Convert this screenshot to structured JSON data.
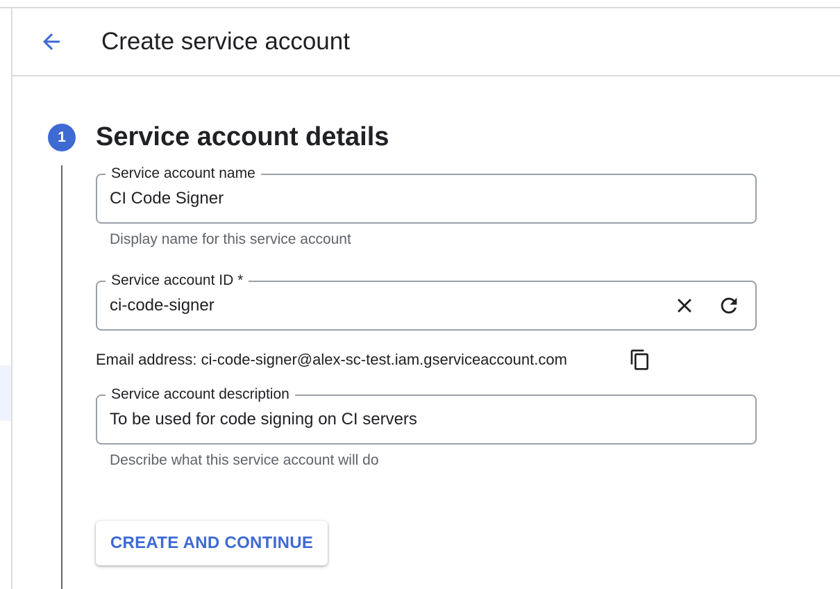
{
  "header": {
    "title": "Create service account",
    "back_icon": "arrow-back-icon"
  },
  "step": {
    "number": "1",
    "title": "Service account details"
  },
  "fields": {
    "name": {
      "label": "Service account name",
      "value": "CI Code Signer",
      "hint": "Display name for this service account"
    },
    "id": {
      "label": "Service account ID *",
      "value": "ci-code-signer",
      "clear_icon": "close-icon",
      "refresh_icon": "refresh-icon"
    },
    "description": {
      "label": "Service account description",
      "value": "To be used for code signing on CI servers",
      "hint": "Describe what this service account will do"
    }
  },
  "email": {
    "text": "Email address: ci-code-signer@alex-sc-test.iam.gserviceaccount.com",
    "copy_icon": "copy-icon"
  },
  "actions": {
    "create_label": "CREATE AND CONTINUE"
  },
  "colors": {
    "accent": "#3e6ad4",
    "border": "#9aa0a6",
    "divider": "#dadce0",
    "hint_text": "#5f6368",
    "text": "#202124"
  }
}
